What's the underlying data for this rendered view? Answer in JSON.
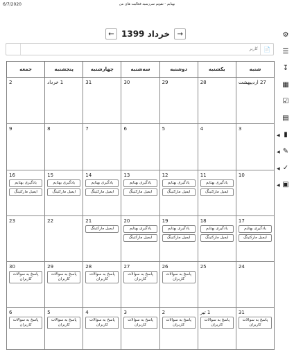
{
  "print": {
    "date": "6/7/2020",
    "title": "بهتایم - تقویم سررسید فعالیت های من"
  },
  "nav": {
    "prev_label": "❮",
    "next_label": "❯",
    "month_label": "خرداد 1399"
  },
  "search": {
    "placeholder": "کاربر",
    "value": ""
  },
  "sidebar": [
    "users-cog-icon",
    "list-icon",
    "download-icon",
    "table-icon",
    "calendar-check-icon",
    "cards-icon",
    "file-icon",
    "pen-icon",
    "check-square-icon",
    "grid-icon"
  ],
  "weekdays": [
    "شنبه",
    "یکشنبه",
    "دوشنبه",
    "سه‌شنبه",
    "چهارشنبه",
    "پنجشنبه",
    "جمعه"
  ],
  "weeks": [
    [
      {
        "day": "27 اردیبهشت",
        "events": []
      },
      {
        "day": "28",
        "events": []
      },
      {
        "day": "29",
        "events": []
      },
      {
        "day": "30",
        "events": []
      },
      {
        "day": "31",
        "events": []
      },
      {
        "day": "1 خرداد",
        "events": []
      },
      {
        "day": "2",
        "events": []
      }
    ],
    [
      {
        "day": "3",
        "events": []
      },
      {
        "day": "4",
        "events": []
      },
      {
        "day": "5",
        "events": []
      },
      {
        "day": "6",
        "events": []
      },
      {
        "day": "7",
        "events": []
      },
      {
        "day": "8",
        "events": []
      },
      {
        "day": "9",
        "events": []
      }
    ],
    [
      {
        "day": "10",
        "events": []
      },
      {
        "day": "11",
        "events": [
          "یادگیری بهتایم",
          "ایمیل مارکتینگ"
        ]
      },
      {
        "day": "12",
        "events": [
          "یادگیری بهتایم",
          "ایمیل مارکتینگ"
        ]
      },
      {
        "day": "13",
        "events": [
          "یادگیری بهتایم",
          "ایمیل مارکتینگ"
        ]
      },
      {
        "day": "14",
        "events": [
          "یادگیری بهتایم",
          "ایمیل مارکتینگ"
        ]
      },
      {
        "day": "15",
        "events": [
          "یادگیری بهتایم",
          "ایمیل مارکتینگ"
        ]
      },
      {
        "day": "16",
        "events": [
          "یادگیری بهتایم",
          "ایمیل مارکتینگ"
        ]
      }
    ],
    [
      {
        "day": "17",
        "events": [
          "یادگیری بهتایم",
          "ایمیل مارکتینگ"
        ]
      },
      {
        "day": "18",
        "events": [
          "یادگیری بهتایم",
          "ایمیل مارکتینگ"
        ]
      },
      {
        "day": "19",
        "events": [
          "یادگیری بهتایم",
          "ایمیل مارکتینگ"
        ]
      },
      {
        "day": "20",
        "events": [
          "یادگیری بهتایم",
          "ایمیل مارکتینگ"
        ]
      },
      {
        "day": "21",
        "events": [
          "ایمیل مارکتینگ"
        ]
      },
      {
        "day": "22",
        "events": []
      },
      {
        "day": "23",
        "events": []
      }
    ],
    [
      {
        "day": "24",
        "events": []
      },
      {
        "day": "25",
        "events": []
      },
      {
        "day": "26",
        "events": [
          "پاسخ به سوالات کاربران"
        ]
      },
      {
        "day": "27",
        "events": [
          "پاسخ به سوالات کاربران"
        ]
      },
      {
        "day": "28",
        "events": [
          "پاسخ به سوالات کاربران"
        ]
      },
      {
        "day": "29",
        "events": [
          "پاسخ به سوالات کاربران"
        ]
      },
      {
        "day": "30",
        "events": [
          "پاسخ به سوالات کاربران"
        ]
      }
    ],
    [
      {
        "day": "31",
        "events": [
          "پاسخ به سوالات کاربران"
        ]
      },
      {
        "day": "1 تیر",
        "events": [
          "پاسخ به سوالات کاربران"
        ]
      },
      {
        "day": "2",
        "events": [
          "پاسخ به سوالات کاربران"
        ]
      },
      {
        "day": "3",
        "events": [
          "پاسخ به سوالات کاربران"
        ]
      },
      {
        "day": "4",
        "events": [
          "پاسخ به سوالات کاربران"
        ]
      },
      {
        "day": "5",
        "events": [
          "پاسخ به سوالات کاربران"
        ]
      },
      {
        "day": "6",
        "events": [
          "پاسخ به سوالات کاربران"
        ]
      }
    ]
  ]
}
